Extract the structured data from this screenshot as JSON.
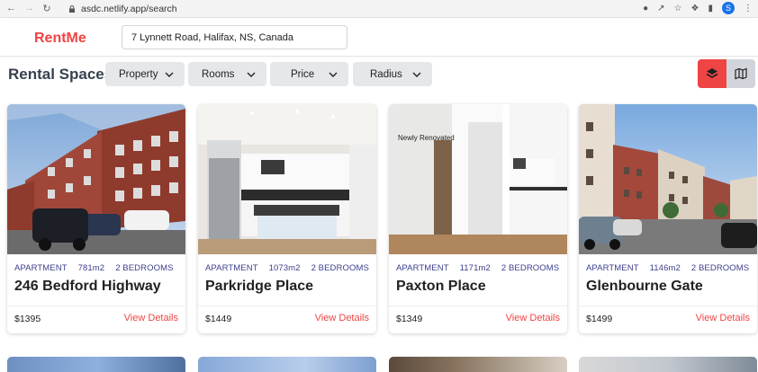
{
  "browser": {
    "url": "asdc.netlify.app/search",
    "profile_initial": "S"
  },
  "header": {
    "logo": "RentMe",
    "search_value": "7 Lynnett Road, Halifax, NS, Canada"
  },
  "toolbar": {
    "title": "Rental Spaces",
    "filters": [
      "Property",
      "Rooms",
      "Price",
      "Radius"
    ]
  },
  "colors": {
    "accent": "#ef4444",
    "meta_text": "#3b3f8c"
  },
  "listings": [
    {
      "type": "APARTMENT",
      "area": "781m2",
      "bedrooms": "2 BEDROOMS",
      "name": "246 Bedford Highway",
      "price": "$1395",
      "details_label": "View Details",
      "photo_caption": ""
    },
    {
      "type": "APARTMENT",
      "area": "1073m2",
      "bedrooms": "2 BEDROOMS",
      "name": "Parkridge Place",
      "price": "$1449",
      "details_label": "View Details",
      "photo_caption": ""
    },
    {
      "type": "APARTMENT",
      "area": "1171m2",
      "bedrooms": "2 BEDROOMS",
      "name": "Paxton Place",
      "price": "$1349",
      "details_label": "View Details",
      "photo_caption": "Newly Renovated"
    },
    {
      "type": "APARTMENT",
      "area": "1146m2",
      "bedrooms": "2 BEDROOMS",
      "name": "Glenbourne Gate",
      "price": "$1499",
      "details_label": "View Details",
      "photo_caption": ""
    }
  ]
}
